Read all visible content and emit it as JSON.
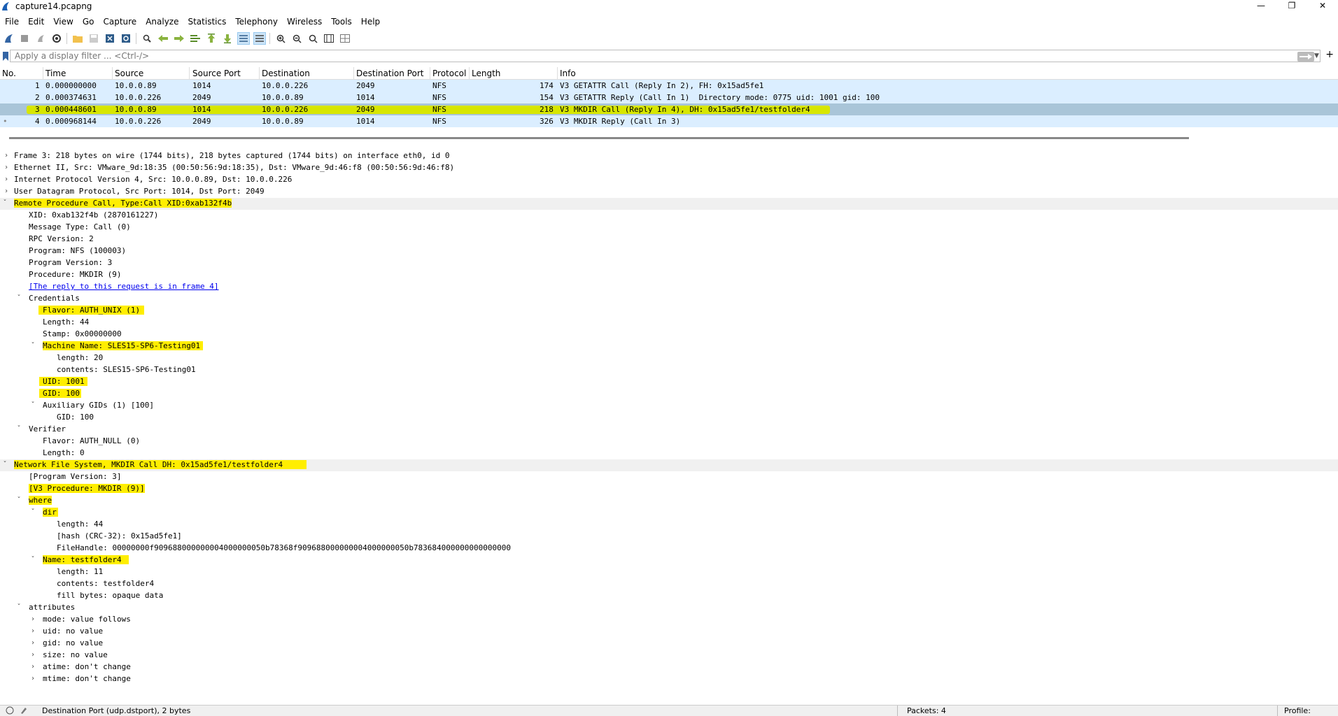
{
  "window": {
    "title": "capture14.pcapng"
  },
  "menu": [
    "File",
    "Edit",
    "View",
    "Go",
    "Capture",
    "Analyze",
    "Statistics",
    "Telephony",
    "Wireless",
    "Tools",
    "Help"
  ],
  "toolbar_icons": [
    "shark-fin-start-icon",
    "stop-icon",
    "restart-icon",
    "options-icon",
    "open-icon",
    "save-icon",
    "close-file-icon",
    "reload-icon",
    "find-icon",
    "back-icon",
    "forward-icon",
    "goto-icon",
    "first-icon",
    "last-icon",
    "autoscroll-icon",
    "colorize-icon",
    "zoom-in-icon",
    "zoom-out-icon",
    "zoom-normal-icon",
    "resize-columns-icon",
    "layout-icon"
  ],
  "filter": {
    "placeholder": "Apply a display filter ... <Ctrl-/>"
  },
  "columns": [
    "No.",
    "Time",
    "Source",
    "Source Port",
    "Destination",
    "Destination Port",
    "Protocol",
    "Length",
    "Info"
  ],
  "packets": [
    {
      "no": "1",
      "time": "0.000000000",
      "src": "10.0.0.89",
      "sport": "1014",
      "dst": "10.0.0.226",
      "dport": "2049",
      "proto": "NFS",
      "len": "174",
      "info": "V3 GETATTR Call (Reply In 2), FH: 0x15ad5fe1"
    },
    {
      "no": "2",
      "time": "0.000374631",
      "src": "10.0.0.226",
      "sport": "2049",
      "dst": "10.0.0.89",
      "dport": "1014",
      "proto": "NFS",
      "len": "154",
      "info": "V3 GETATTR Reply (Call In 1)  Directory mode: 0775 uid: 1001 gid: 100"
    },
    {
      "no": "3",
      "time": "0.000448601",
      "src": "10.0.0.89",
      "sport": "1014",
      "dst": "10.0.0.226",
      "dport": "2049",
      "proto": "NFS",
      "len": "218",
      "info": "V3 MKDIR Call (Reply In 4), DH: 0x15ad5fe1/testfolder4"
    },
    {
      "no": "4",
      "time": "0.000968144",
      "src": "10.0.0.226",
      "sport": "2049",
      "dst": "10.0.0.89",
      "dport": "1014",
      "proto": "NFS",
      "len": "326",
      "info": "V3 MKDIR Reply (Call In 3)"
    }
  ],
  "details": [
    "Frame 3: 218 bytes on wire (1744 bits), 218 bytes captured (1744 bits) on interface eth0, id 0",
    "Ethernet II, Src: VMware_9d:18:35 (00:50:56:9d:18:35), Dst: VMware_9d:46:f8 (00:50:56:9d:46:f8)",
    "Internet Protocol Version 4, Src: 10.0.0.89, Dst: 10.0.0.226",
    "User Datagram Protocol, Src Port: 1014, Dst Port: 2049",
    "Remote Procedure Call, Type:Call XID:0xab132f4b",
    "XID: 0xab132f4b (2870161227)",
    "Message Type: Call (0)",
    "RPC Version: 2",
    "Program: NFS (100003)",
    "Program Version: 3",
    "Procedure: MKDIR (9)",
    "[The reply to this request is in frame 4]",
    "Credentials",
    "Flavor: AUTH_UNIX (1)",
    "Length: 44",
    "Stamp: 0x00000000",
    "Machine Name: SLES15-SP6-Testing01",
    "length: 20",
    "contents: SLES15-SP6-Testing01",
    "UID: 1001",
    "GID: 100",
    "Auxiliary GIDs (1) [100]",
    "GID: 100",
    "Verifier",
    "Flavor: AUTH_NULL (0)",
    "Length: 0",
    "Network File System, MKDIR Call DH: 0x15ad5fe1/testfolder4",
    "[Program Version: 3]",
    "[V3 Procedure: MKDIR (9)]",
    "where",
    "dir",
    "length: 44",
    "[hash (CRC-32): 0x15ad5fe1]",
    "FileHandle: 00000000f909688000000004000000050b78368f909688000000004000000050b783684000000000000000",
    "Name: testfolder4",
    "length: 11",
    "contents: testfolder4",
    "fill bytes: opaque data",
    "attributes",
    "mode: value follows",
    "uid: no value",
    "gid: no value",
    "size: no value",
    "atime: don't change",
    "mtime: don't change"
  ],
  "status": {
    "field": "Destination Port (udp.dstport), 2 bytes",
    "packets": "Packets: 4",
    "profile": "Profile: Default"
  },
  "colors": {
    "selected_row": "#a9c5d8",
    "nfs_row": "#dbeeff",
    "highlight": "#ffee00"
  }
}
